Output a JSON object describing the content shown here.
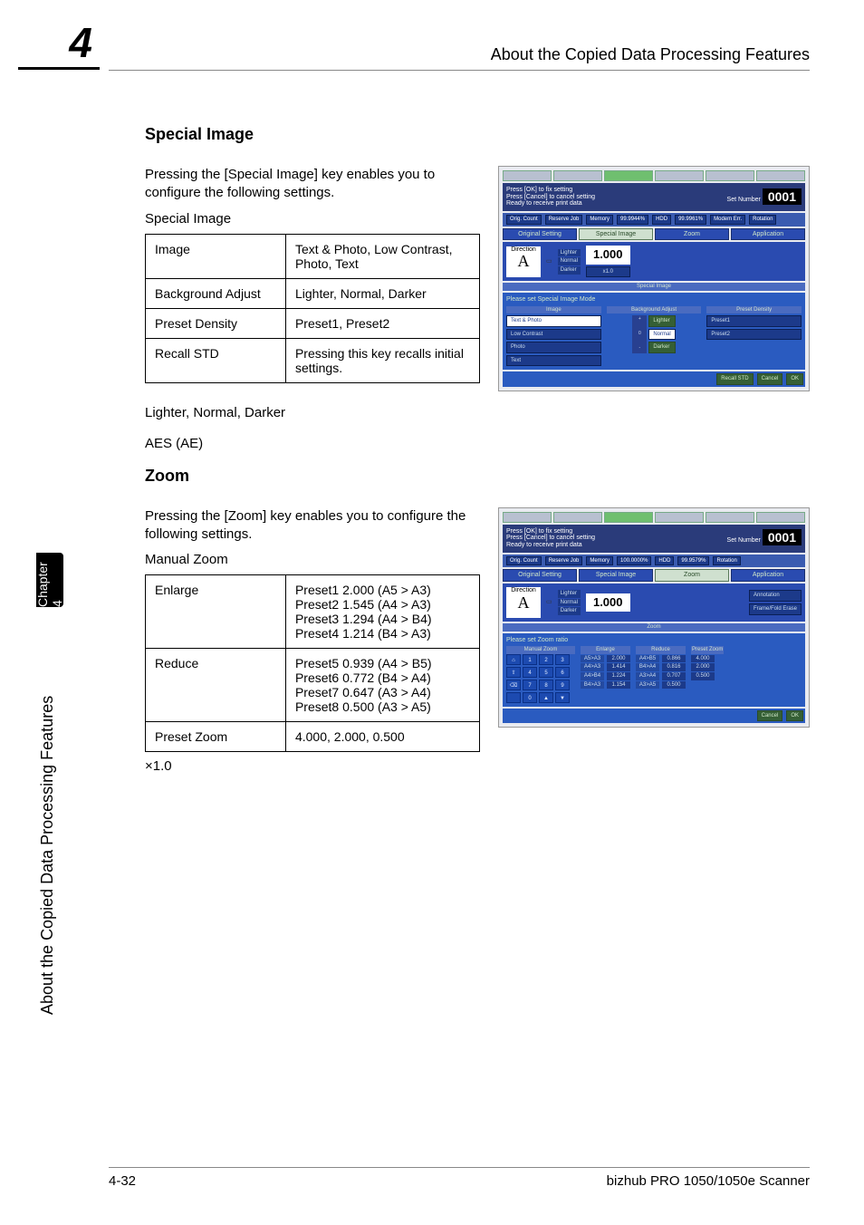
{
  "header": {
    "chapter_number": "4",
    "title": "About the Copied Data Processing Features"
  },
  "side": {
    "tab": "Chapter 4",
    "label": "About the Copied Data Processing Features"
  },
  "special_image": {
    "heading": "Special Image",
    "intro": "Pressing the [Special Image] key enables you to configure the following settings.",
    "subhead": "Special Image",
    "table": [
      {
        "k": "Image",
        "v": "Text & Photo, Low Contrast, Photo, Text"
      },
      {
        "k": "Background Adjust",
        "v": "Lighter, Normal, Darker"
      },
      {
        "k": "Preset Density",
        "v": "Preset1, Preset2"
      },
      {
        "k": "Recall STD",
        "v": "Pressing this key recalls initial settings."
      }
    ],
    "line1": "Lighter, Normal, Darker",
    "line2": "AES (AE)"
  },
  "zoom": {
    "heading": "Zoom",
    "intro": "Pressing the [Zoom] key enables you to configure the following settings.",
    "subhead": "Manual Zoom",
    "table": [
      {
        "k": "Enlarge",
        "v": "Preset1 2.000 (A5 > A3)\nPreset2 1.545 (A4 > A3)\nPreset3 1.294 (A4 > B4)\nPreset4 1.214 (B4 > A3)"
      },
      {
        "k": "Reduce",
        "v": "Preset5 0.939 (A4 > B5)\nPreset6 0.772 (B4 > A4)\nPreset7 0.647 (A3 > A4)\nPreset8 0.500 (A3 > A5)"
      },
      {
        "k": "Preset Zoom",
        "v": "4.000, 2.000, 0.500"
      }
    ],
    "line1": "×1.0"
  },
  "screenshot_common": {
    "msg1": "Press [OK] to fix setting",
    "msg2": "Press [Cancel] to cancel setting",
    "msg3": "Ready to receive print data",
    "set_number_label": "Set Number",
    "set_number": "0001",
    "orig_count": "Orig. Count",
    "reserve_job": "Reserve Job",
    "memory": "Memory",
    "hdd": "HDD",
    "rotation": "Rotation",
    "direction": "Direction",
    "A": "A",
    "lighter": "Lighter",
    "normal": "Normal",
    "darker": "Darker",
    "one_thousand": "1.000",
    "x10": "x1.0",
    "tabs": {
      "original": "Original Setting",
      "special": "Special Image",
      "zoom": "Zoom",
      "application": "Application"
    },
    "ok": "OK",
    "cancel": "Cancel"
  },
  "ss_special": {
    "mem_pct": "99.9944%",
    "hdd_pct": "99.9961%",
    "modem_err": "Modem Err.",
    "banner": "Special Image",
    "prompt": "Please set Special Image Mode",
    "image_label": "Image",
    "bg_label": "Background Adjust",
    "pd_label": "Preset Density",
    "opts": {
      "text_photo": "Text & Photo",
      "low_contrast": "Low Contrast",
      "photo": "Photo",
      "text": "Text"
    },
    "preset1": "Preset1",
    "preset2": "Preset2",
    "recall_std": "Recall STD"
  },
  "ss_zoom": {
    "mem_pct": "100.0000%",
    "hdd_pct": "99.9579%",
    "banner": "Zoom",
    "prompt": "Please set Zoom ratio",
    "annotation": "Annotation",
    "frame_erase": "Frame/Fold Erase",
    "manual_zoom": "Manual Zoom",
    "enlarge": "Enlarge",
    "reduce": "Reduce",
    "preset_zoom": "Preset Zoom",
    "enlarge_rows": [
      {
        "k": "A5>A3",
        "v": "2.000"
      },
      {
        "k": "A4>A3",
        "v": "1.414"
      },
      {
        "k": "A4>B4",
        "v": "1.224"
      },
      {
        "k": "B4>A3",
        "v": "1.154"
      }
    ],
    "reduce_rows": [
      {
        "k": "A4>B5",
        "v": "0.866"
      },
      {
        "k": "B4>A4",
        "v": "0.816"
      },
      {
        "k": "A3>A4",
        "v": "0.707"
      },
      {
        "k": "A3>A5",
        "v": "0.500"
      }
    ],
    "preset_rows": [
      "4.000",
      "2.000",
      "0.500"
    ],
    "keys": [
      "1",
      "2",
      "3",
      "4",
      "5",
      "6",
      "7",
      "8",
      "9",
      "0",
      "▲",
      "▼"
    ]
  },
  "footer": {
    "page": "4-32",
    "product": "bizhub PRO 1050/1050e Scanner"
  }
}
